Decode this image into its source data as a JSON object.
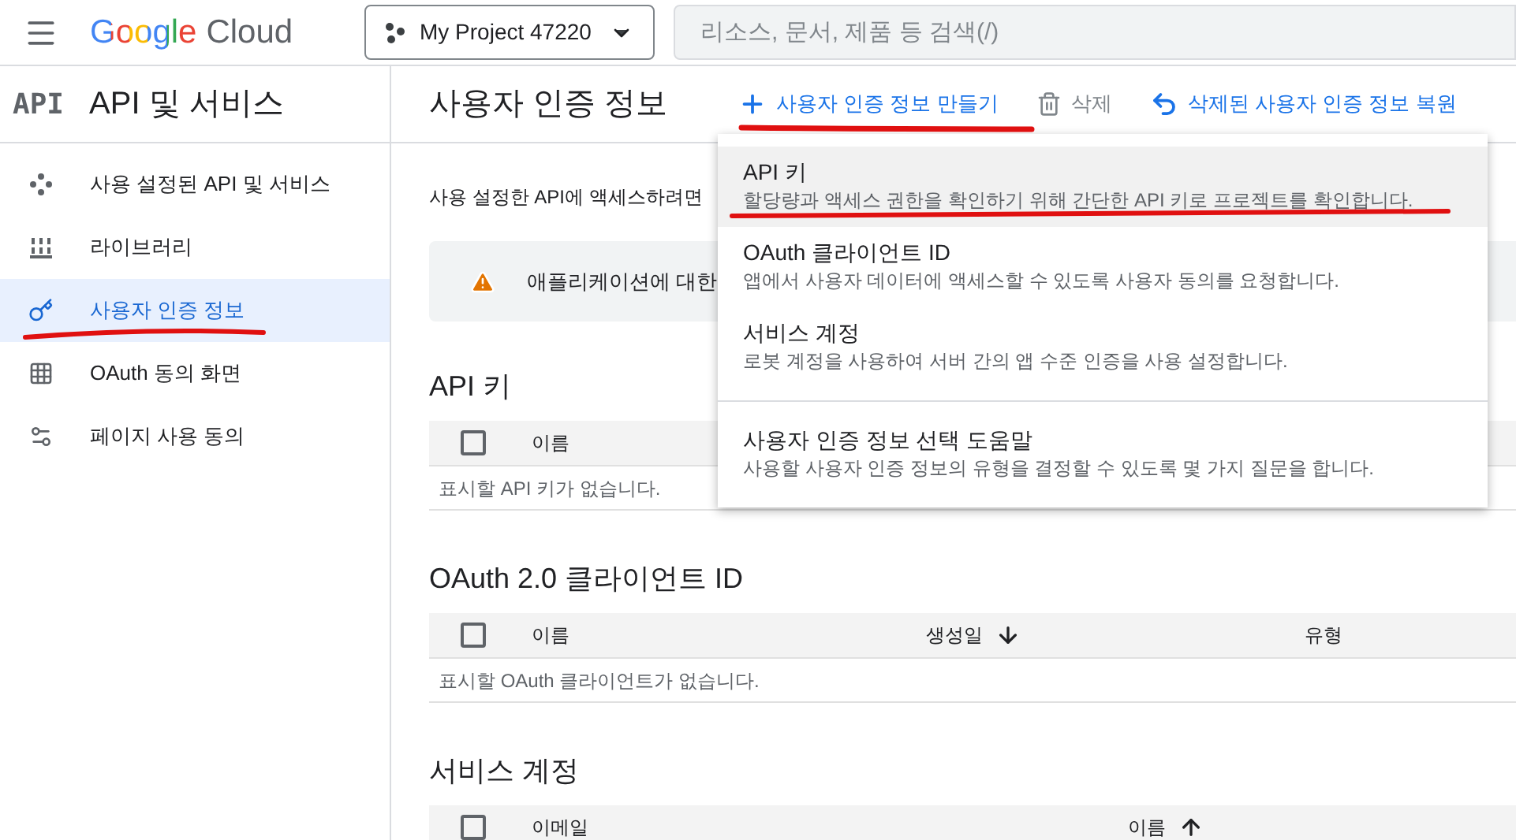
{
  "topbar": {
    "brand": "Google",
    "product": "Cloud",
    "project": "My Project 47220",
    "search": {
      "placeholder": "리소스, 문서, 제품 등 검색(/)"
    }
  },
  "sidebar": {
    "badge": "API",
    "title": "API 및 서비스",
    "items": [
      {
        "label": "사용 설정된 API 및 서비스",
        "selected": false
      },
      {
        "label": "라이브러리",
        "selected": false
      },
      {
        "label": "사용자 인증 정보",
        "selected": true
      },
      {
        "label": "OAuth 동의 화면",
        "selected": false
      },
      {
        "label": "페이지 사용 동의",
        "selected": false
      }
    ]
  },
  "header": {
    "title": "사용자 인증 정보",
    "actions": [
      {
        "kind": "create",
        "label": "사용자 인증 정보 만들기",
        "disabled": false
      },
      {
        "kind": "delete",
        "label": "삭제",
        "disabled": true
      },
      {
        "kind": "restore",
        "label": "삭제된 사용자 인증 정보 복원",
        "disabled": false
      }
    ]
  },
  "intro": "사용 설정한 API에 액세스하려면",
  "banner": {
    "text": "애플리케이션에 대한"
  },
  "sections": [
    {
      "title": "API 키",
      "checked": false,
      "columns": [
        {
          "label": "이름",
          "sorted_down": false,
          "sorted_up": false
        }
      ],
      "empty": "표시할 API 키가 없습니다."
    },
    {
      "title": "OAuth 2.0 클라이언트 ID",
      "checked": false,
      "columns": [
        {
          "label": "이름",
          "sorted_down": false,
          "sorted_up": false
        },
        {
          "label": "생성일",
          "sorted_down": true,
          "sorted_up": false
        },
        {
          "label": "유형",
          "sorted_down": false,
          "sorted_up": false
        }
      ],
      "empty": "표시할 OAuth 클라이언트가 없습니다."
    },
    {
      "title": "서비스 계정",
      "checked": false,
      "columns": [
        {
          "label": "이메일",
          "sorted_down": false,
          "sorted_up": false
        },
        {
          "label": "이름",
          "sorted_down": false,
          "sorted_up": true
        }
      ]
    }
  ],
  "menu": {
    "groups": [
      [
        {
          "title": "API 키",
          "description": "할당량과 액세스 권한을 확인하기 위해 간단한 API 키로 프로젝트를 확인합니다.",
          "highlighted": true
        },
        {
          "title": "OAuth 클라이언트 ID",
          "description": "앱에서 사용자 데이터에 액세스할 수 있도록 사용자 동의를 요청합니다.",
          "highlighted": false
        },
        {
          "title": "서비스 계정",
          "description": "로봇 계정을 사용하여 서버 간의 앱 수준 인증을 사용 설정합니다.",
          "highlighted": false
        }
      ],
      [
        {
          "title": "사용자 인증 정보 선택 도움말",
          "description": "사용할 사용자 인증 정보의 유형을 결정할 수 있도록 몇 가지 질문을 합니다.",
          "highlighted": false
        }
      ]
    ]
  }
}
